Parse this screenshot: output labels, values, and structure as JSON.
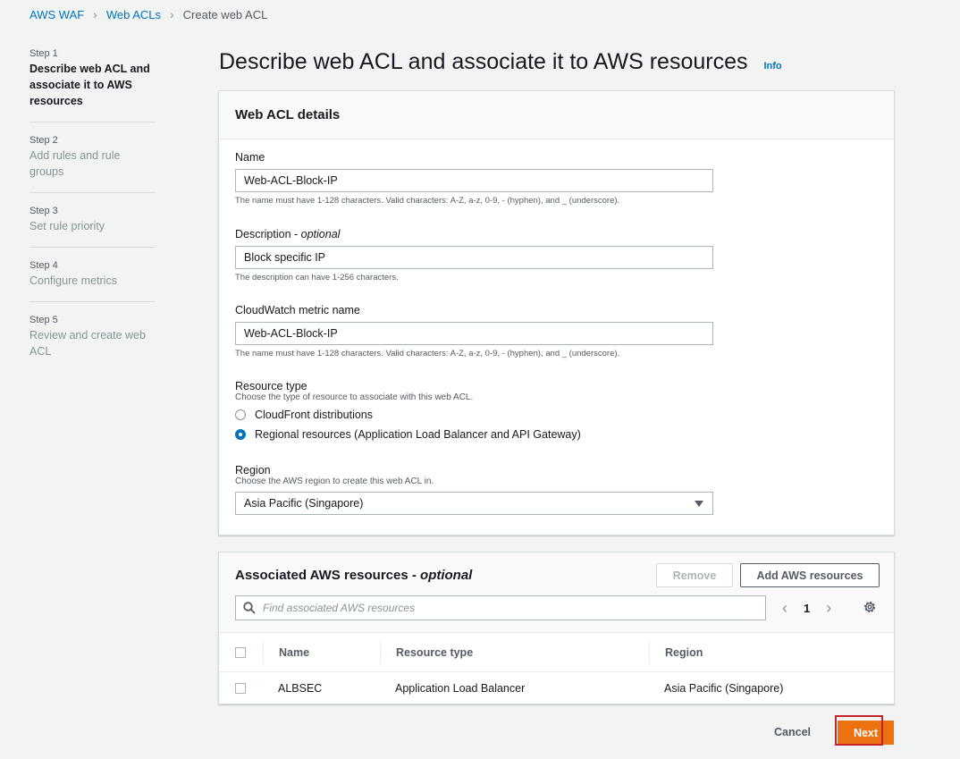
{
  "breadcrumb": {
    "root": "AWS WAF",
    "parent": "Web ACLs",
    "current": "Create web ACL"
  },
  "steps": [
    {
      "num": "Step 1",
      "label": "Describe web ACL and associate it to AWS resources"
    },
    {
      "num": "Step 2",
      "label": "Add rules and rule groups"
    },
    {
      "num": "Step 3",
      "label": "Set rule priority"
    },
    {
      "num": "Step 4",
      "label": "Configure metrics"
    },
    {
      "num": "Step 5",
      "label": "Review and create web ACL"
    }
  ],
  "page": {
    "title": "Describe web ACL and associate it to AWS resources",
    "info": "Info"
  },
  "details": {
    "header": "Web ACL details",
    "name_label": "Name",
    "name_value": "Web-ACL-Block-IP",
    "name_constraint": "The name must have 1-128 characters. Valid characters: A-Z, a-z, 0-9, - (hyphen), and _ (underscore).",
    "desc_label": "Description - ",
    "desc_optional": "optional",
    "desc_value": "Block specific IP",
    "desc_constraint": "The description can have 1-256 characters.",
    "metric_label": "CloudWatch metric name",
    "metric_value": "Web-ACL-Block-IP",
    "metric_constraint": "The name must have 1-128 characters. Valid characters: A-Z, a-z, 0-9, - (hyphen), and _ (underscore).",
    "resource_label": "Resource type",
    "resource_desc": "Choose the type of resource to associate with this web ACL.",
    "resource_opt1": "CloudFront distributions",
    "resource_opt2": "Regional resources (Application Load Balancer and API Gateway)",
    "region_label": "Region",
    "region_desc": "Choose the AWS region to create this web ACL in.",
    "region_value": "Asia Pacific (Singapore)"
  },
  "resources": {
    "title": "Associated AWS resources - ",
    "title_optional": "optional",
    "remove_label": "Remove",
    "add_label": "Add AWS resources",
    "search_placeholder": "Find associated AWS resources",
    "page": "1",
    "columns": [
      "Name",
      "Resource type",
      "Region"
    ],
    "rows": [
      {
        "name": "ALBSEC",
        "type": "Application Load Balancer",
        "region": "Asia Pacific (Singapore)"
      }
    ]
  },
  "footer": {
    "cancel": "Cancel",
    "next": "Next"
  },
  "colors": {
    "link": "#0073bb",
    "primary": "#ec7211",
    "highlight": "#c7232a"
  }
}
